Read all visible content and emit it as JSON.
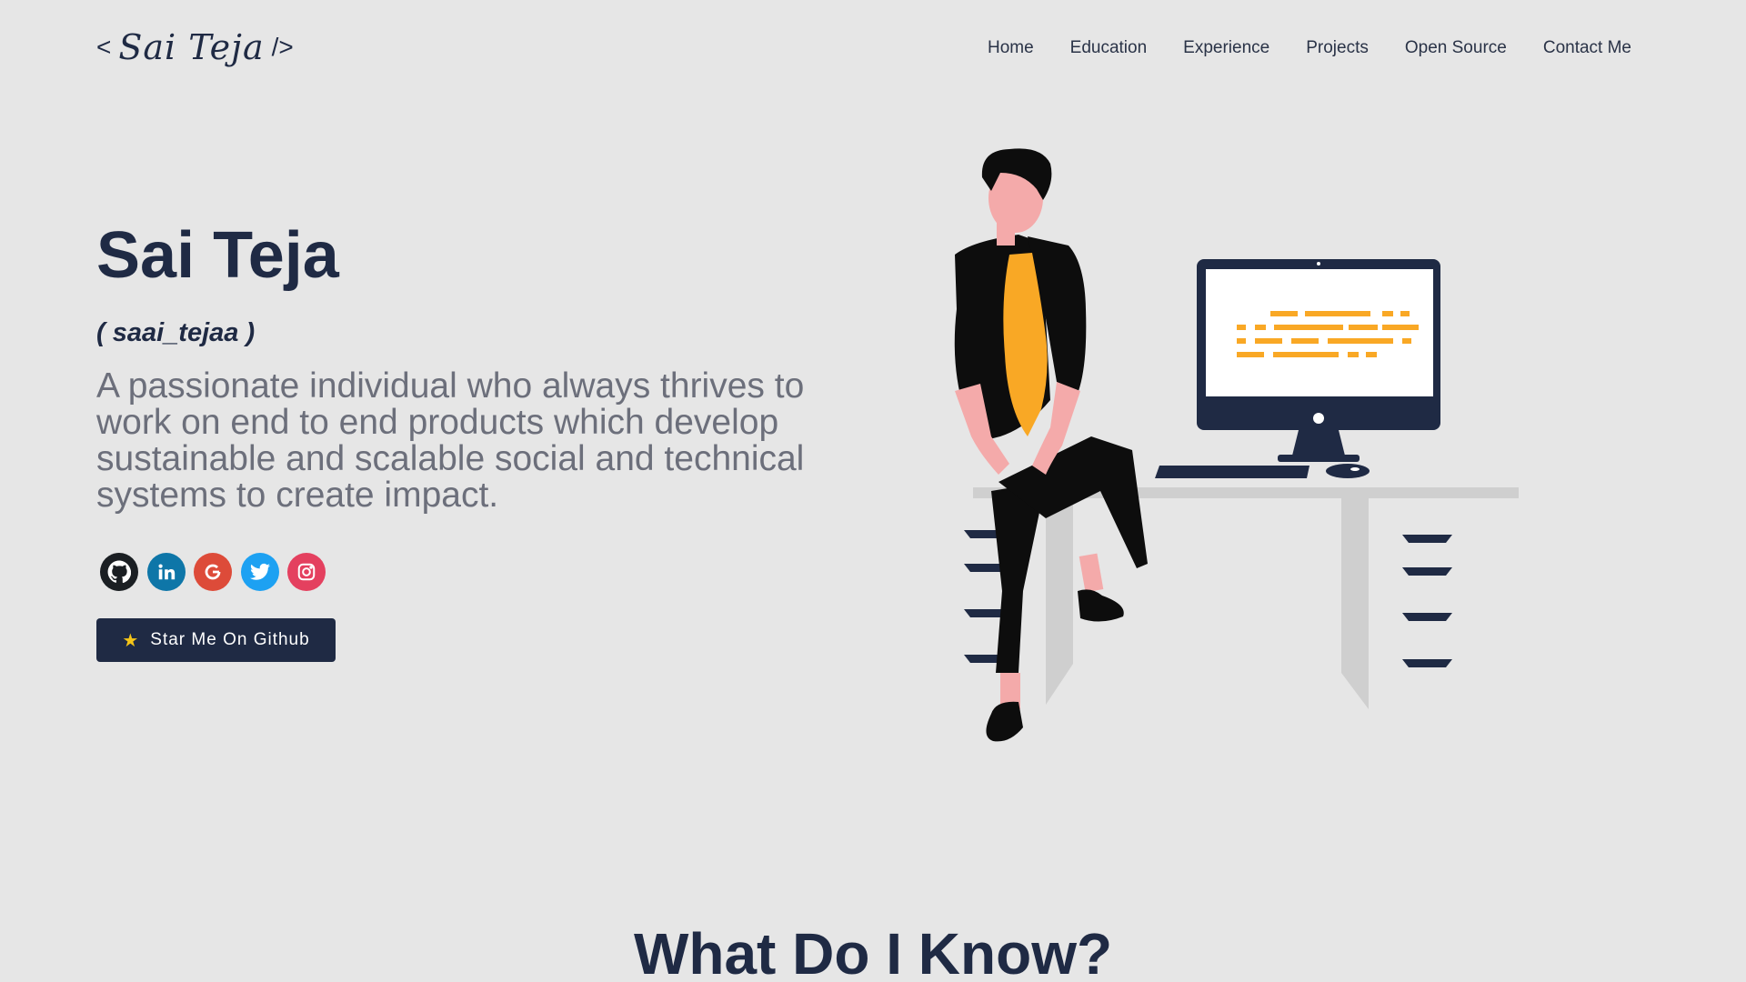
{
  "header": {
    "logo": {
      "open": "<",
      "name": "Sai Teja",
      "close": "/>"
    },
    "nav": [
      "Home",
      "Education",
      "Experience",
      "Projects",
      "Open Source",
      "Contact Me"
    ]
  },
  "hero": {
    "name": "Sai Teja",
    "handle": "( saai_tejaa )",
    "tagline": "A passionate individual who always thrives to work on end to end products which develop sustainable and scalable social and technical systems to create impact.",
    "socials": [
      {
        "name": "github",
        "icon": "github-icon",
        "color": "#1b1f23"
      },
      {
        "name": "linkedin",
        "icon": "linkedin-icon",
        "color": "#0e76a8"
      },
      {
        "name": "google",
        "icon": "google-icon",
        "color": "#dd4b39"
      },
      {
        "name": "twitter",
        "icon": "twitter-icon",
        "color": "#1da1f2"
      },
      {
        "name": "instagram",
        "icon": "instagram-icon",
        "color": "#e4405f"
      }
    ],
    "cta": {
      "label": "Star Me On Github",
      "icon": "star-icon"
    }
  },
  "section": {
    "title": "What Do I Know?"
  },
  "colors": {
    "background": "#e6e6e6",
    "primary": "#1f2a44",
    "accent": "#f9a825"
  }
}
